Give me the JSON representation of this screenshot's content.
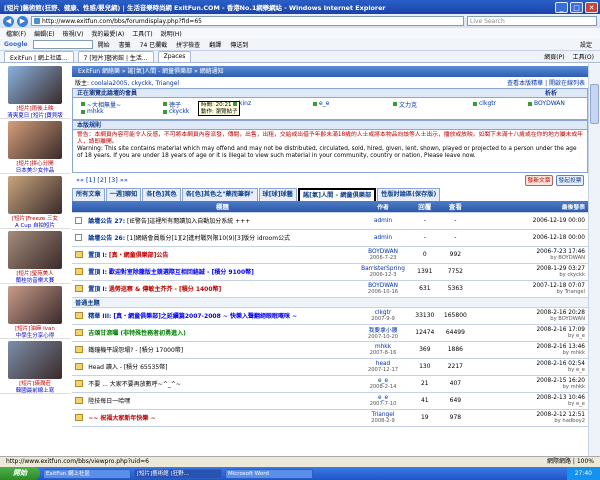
{
  "window": {
    "title": "[短片]藝術館(狂野、健康、性感/嬰兒網) | 生活音樂時尚網 ExitFun.COM - 香港No.1網樂網站 - Windows Internet Explorer",
    "min": "_",
    "max": "□",
    "close": "✕"
  },
  "address": {
    "url": "http://www.exitfun.com/bbs/forumdisplay.php?fid=65",
    "search_placeholder": "Live Search"
  },
  "menu": [
    "檔案(F)",
    "編輯(E)",
    "檢視(V)",
    "我的最愛(A)",
    "工具(T)",
    "說明(H)"
  ],
  "google": {
    "label": "Google",
    "btns": [
      "開始",
      "書籤",
      "74 已攔截",
      "拼字檢查",
      "翻譯",
      "傳送到"
    ],
    "settings": "設定"
  },
  "tabs": {
    "items": [
      "ExitFun | 網上社區...",
      "7 [短片]藝術館 | 生活...",
      "Zpaces"
    ],
    "right": [
      "網頁(P)",
      "工具(O)"
    ]
  },
  "left_ads": [
    {
      "c1": "[短片]雨後上映",
      "c2": "清爽夏日 [短片]寶貝版",
      "col": "#8ab2e0"
    },
    {
      "c1": "[短片]拼心分開",
      "c2": "日本美少女作品",
      "col": "#d59f7a"
    },
    {
      "c1": "[短片]Freeze 三女",
      "c2": "A Cup 自拍短片",
      "col": "#c8a67f"
    },
    {
      "c1": "[短片]瑩苑美人",
      "c2": "蘭桂坊音樂大賽",
      "col": "#a48c7d"
    },
    {
      "c1": "[短片]油麻 Ivan",
      "c2": "中學生分享心得",
      "col": "#c89c8a"
    },
    {
      "c1": "[短片]瑛潤莊",
      "c2": "韓國最前線上寫",
      "col": "#7d8fa9"
    }
  ],
  "breadcrumb": "ExitFun 網絡樂 » 謠[氣]人間 - 網童俱樂部 » 網絡通知",
  "moderators": {
    "label": "版主:",
    "list": "coolala2005, ckyckk, Triangel",
    "right": "查看本版精華 | 開啟在線列表"
  },
  "online": {
    "title": "正在瀏覽此論壇的會員",
    "right": "析析",
    "users": [
      "~大相無量~",
      "mhkk",
      "徳子",
      "ckyckk",
      "kinz",
      "e_e",
      "文力克",
      "clkgtr",
      "BOYDWAN"
    ],
    "tip1": "時間: 20:21",
    "tip2": "動作: 瀏覽帖子"
  },
  "rules": {
    "title": "本版規則",
    "l1": "警告：本網頁內容可能令人反感，不可將本網頁內容派發，傳閱，出售，出租，交給或出借予年齡未滿18歲的人士或將本物品向該等人士出示，播放或放映。如閣下未滿十八歲或在你的地方屬未成年人，請即離開。",
    "l2": "Warning: This site contains material which may offend and may not be distributed, circulated, sold, hired, given, lent, shown, played or projected to a person under the age of 18 years. If you are under 18 years of age or it is illegal to view such material in your community, country or nation, Please leave now."
  },
  "pager": {
    "text": "«« [1] [2] [3] »»",
    "new_topic": "發新文章",
    "new_poll": "發起投票"
  },
  "forum_tabs": [
    "所有文章",
    "一週]聊知",
    "各[色]其色",
    "各[色]其色之\"藥而筆群\"",
    "球[球]球藝",
    "謠[氣]人間 - 網童俱樂部",
    "性版討論區(保存版)"
  ],
  "table": {
    "head": [
      "標題",
      "作者",
      "回覆",
      "查看",
      "最後發表"
    ],
    "rows": [
      {
        "t": "論壇公告 27:",
        "ti": "[IE警告]這裡所有閱讀加入自動加分系統 +++",
        "a": "admin",
        "d": "",
        "r": "-",
        "v": "-",
        "l": "2006-12-19 00:00",
        "lb": "",
        "cls": "ti"
      },
      {
        "t": "論壇公告 26:",
        "ti": "[1]網絡會員版分[1][2]進村戰列限10(9)[3]版分 idroom公式",
        "a": "admin",
        "d": "",
        "r": "-",
        "v": "-",
        "l": "2006-12-18 00:00",
        "lb": "",
        "cls": "ti"
      },
      {
        "t": "置頂 I:",
        "ti": "[真・網童俱樂部]公告",
        "a": "BOYDWAN",
        "d": "2006-7-23",
        "r": "0",
        "v": "992",
        "l": "2006-7-23 17:46",
        "lb": "by BOYDWAN",
        "cls": "hot"
      },
      {
        "t": "置頂 I:",
        "ti": "歡迎對室除籠版主競選際互相回絡誠 - [積分 9100幣]",
        "a": "BarristerSpring",
        "d": "2006-12-3",
        "r": "1391",
        "v": "7752",
        "l": "2008-1-29 03:27",
        "lb": "by ckyckk",
        "cls": "blue"
      },
      {
        "t": "置頂 I:",
        "ti": "過勞巡察 & 傳敏主芥芥 - [積分 1400幣]",
        "a": "BOYDWAN",
        "d": "2006-10-16",
        "r": "631",
        "v": "5363",
        "l": "2007-12-18 07:07",
        "lb": "by Triangel",
        "cls": "hot"
      }
    ],
    "section": "普通主題",
    "rows2": [
      {
        "t": "精華 III:",
        "ti": "[真・網童俱樂部]之延續篇2007-2008 ~ 快樂入聲翻絕眼眠嘅咪 ~",
        "a": "clkgtr",
        "d": "2007-9-9",
        "r": "33130",
        "v": "165800",
        "l": "2008-2-16 20:28",
        "lb": "by BOYDWAN",
        "cls": "blue"
      },
      {
        "t": "",
        "ti": "吉頌甘滾囉 (非特殊性務者初勇進入)",
        "a": "我要拿小腰",
        "d": "2007-10-20",
        "r": "12474",
        "v": "64499",
        "l": "2008-2-16 17:09",
        "lb": "by e_e",
        "cls": "green"
      },
      {
        "t": "",
        "ti": "鐵鐘機平誤怨塌? - [積分 17000幣]",
        "a": "mhkk",
        "d": "2007-8-16",
        "r": "369",
        "v": "1886",
        "l": "2008-2-16 13:46",
        "lb": "by mhkk",
        "cls": "ti"
      },
      {
        "t": "",
        "ti": "Head 讀入 - [積分 65535幣]",
        "a": "head",
        "d": "2007-12-17",
        "r": "130",
        "v": "2217",
        "l": "2008-2-16 02:54",
        "lb": "by e_e",
        "cls": "ti"
      },
      {
        "t": "",
        "ti": "不要 ... 大家不要再放數呼~^_^~",
        "a": "e_e",
        "d": "2008-2-14",
        "r": "21",
        "v": "407",
        "l": "2008-2-15 16:20",
        "lb": "by mhkk",
        "cls": "ti"
      },
      {
        "t": "",
        "ti": "陸技每日一哈嘿",
        "a": "e_e",
        "d": "2007-7-10",
        "r": "41",
        "v": "649",
        "l": "2008-2-13 10:46",
        "lb": "by e_e",
        "cls": "ti"
      },
      {
        "t": "",
        "ti": "~~ 祝福大家新年快樂 ~",
        "a": "Triangel",
        "d": "2008-2-9",
        "r": "19",
        "v": "978",
        "l": "2008-2-12 12:51",
        "lb": "by hadboy2",
        "cls": "hot"
      }
    ]
  },
  "status": {
    "left": "http://www.exitfun.com/bbs/viewpro.php?uid=6",
    "right": "網際網路 | 100%"
  },
  "taskbar": {
    "start": "開始",
    "items": [
      "ExitFun 網上社區",
      "[短片]藝術館 (狂野...",
      "Microsoft Word"
    ],
    "time": "27:40"
  }
}
